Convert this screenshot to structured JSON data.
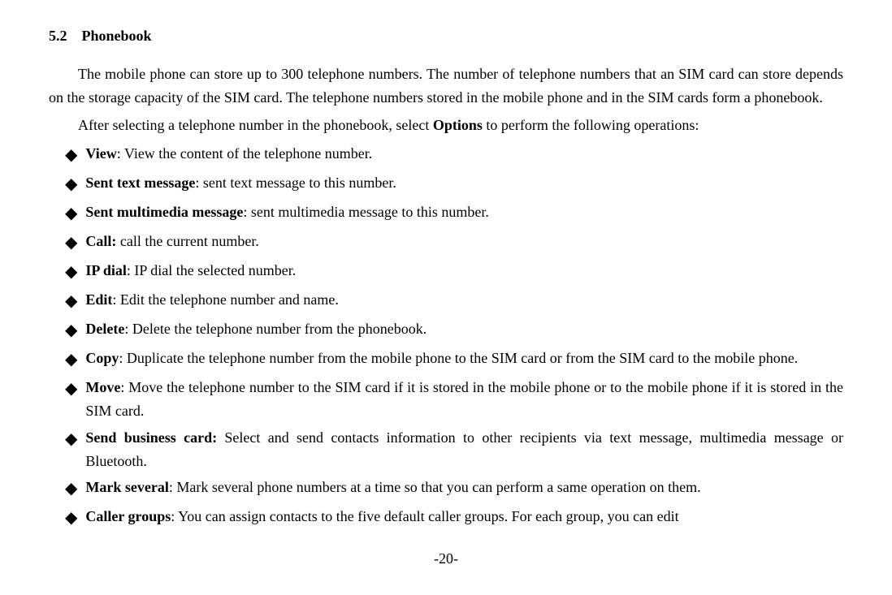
{
  "section": {
    "number": "5.2",
    "title": "Phonebook",
    "paragraphs": [
      "The mobile phone can store up to 300 telephone numbers. The number of telephone numbers that an SIM card can store depends on the storage capacity of the SIM card. The telephone numbers stored in the mobile phone and in the SIM cards form a phonebook.",
      "After selecting a telephone number in the phonebook, select Options to perform the following operations:"
    ],
    "paragraph2_before_options": "Options",
    "paragraph2_before": "After selecting a telephone number in the phonebook, select ",
    "paragraph2_after": " to perform the following operations:"
  },
  "items": [
    {
      "term": "View",
      "bold": true,
      "separator": ": ",
      "description": "View the content of the telephone number."
    },
    {
      "term": "Sent text message",
      "bold": true,
      "separator": ": ",
      "description": "sent text message to this number."
    },
    {
      "term": "Sent multimedia message",
      "bold": true,
      "separator": ": ",
      "description": "sent multimedia message to this number."
    },
    {
      "term": "Call:",
      "bold": true,
      "separator": " ",
      "description": "call the current number."
    },
    {
      "term": "IP dial",
      "bold": true,
      "separator": ": ",
      "description": "IP dial the selected number."
    },
    {
      "term": "Edit",
      "bold": true,
      "separator": ": ",
      "description": "Edit the telephone number and name."
    },
    {
      "term": "Delete",
      "bold": true,
      "separator": ": ",
      "description": "Delete the telephone number from the phonebook."
    },
    {
      "term": "Copy",
      "bold": true,
      "separator": ": ",
      "description": "Duplicate the telephone number from the mobile phone to the SIM card or from the SIM card to the mobile phone."
    },
    {
      "term": "Move",
      "bold": true,
      "separator": ": ",
      "description": "Move the telephone number to the SIM card if it is stored in the mobile phone or to the mobile phone if it is stored in the SIM card."
    },
    {
      "term": "Send business card:",
      "bold": true,
      "separator": " ",
      "description": "Select and send contacts information to other recipients via text message, multimedia message or Bluetooth."
    },
    {
      "term": "Mark several",
      "bold": true,
      "separator": ": ",
      "description": "Mark several phone numbers at a time so that you can perform a same operation on them."
    },
    {
      "term": "Caller groups",
      "bold": true,
      "separator": ": ",
      "description": "You can assign contacts to the five default caller groups. For each group, you can edit"
    }
  ],
  "page_number": "-20-"
}
